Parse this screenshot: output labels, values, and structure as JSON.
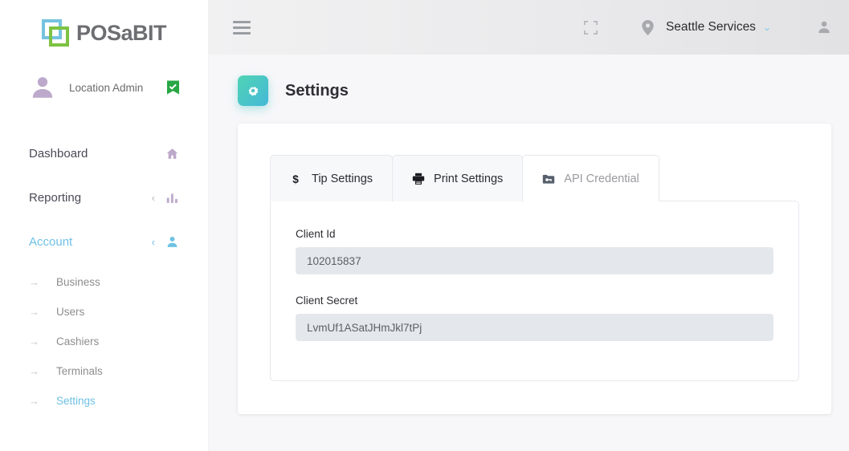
{
  "brand": {
    "name": "POSaBIT",
    "logo_blue": "#76c3e0",
    "logo_green": "#7dc242",
    "accent": "#6ec1e4"
  },
  "sidebar": {
    "user": {
      "name": "Location Admin",
      "verified_icon": "verified-check-badge",
      "avatar_icon": "person-avatar-icon"
    },
    "nav": [
      {
        "label": "Dashboard",
        "icon": "home-icon",
        "active": false,
        "has_chevron": false
      },
      {
        "label": "Reporting",
        "icon": "bar-chart-icon",
        "active": false,
        "has_chevron": true
      },
      {
        "label": "Account",
        "icon": "person-icon",
        "active": true,
        "has_chevron": true
      }
    ],
    "sub_items": [
      {
        "label": "Business",
        "active": false
      },
      {
        "label": "Users",
        "active": false
      },
      {
        "label": "Cashiers",
        "active": false
      },
      {
        "label": "Terminals",
        "active": false
      },
      {
        "label": "Settings",
        "active": true
      }
    ],
    "sub_arrow_glyph": "→",
    "chevron_glyph": "‹"
  },
  "topbar": {
    "menu_icon": "hamburger-menu-icon",
    "fullscreen_icon": "fullscreen-expand-icon",
    "location_icon": "location-pin-icon",
    "location_name": "Seattle Services",
    "location_chevron": "⌄",
    "account_icon": "person-account-icon"
  },
  "page": {
    "title": "Settings",
    "badge_icon": "gear-icon",
    "badge_gradient_from": "#4fd4b4",
    "badge_gradient_to": "#45b8d8"
  },
  "tabs": [
    {
      "label": "Tip Settings",
      "icon": "dollar-sign-icon",
      "active": false
    },
    {
      "label": "Print Settings",
      "icon": "printer-icon",
      "active": false
    },
    {
      "label": "API Credential",
      "icon": "key-card-icon",
      "active": true
    }
  ],
  "form": {
    "fields": [
      {
        "label": "Client Id",
        "value": "102015837"
      },
      {
        "label": "Client Secret",
        "value": "LvmUf1ASatJHmJkl7tPj"
      }
    ]
  }
}
